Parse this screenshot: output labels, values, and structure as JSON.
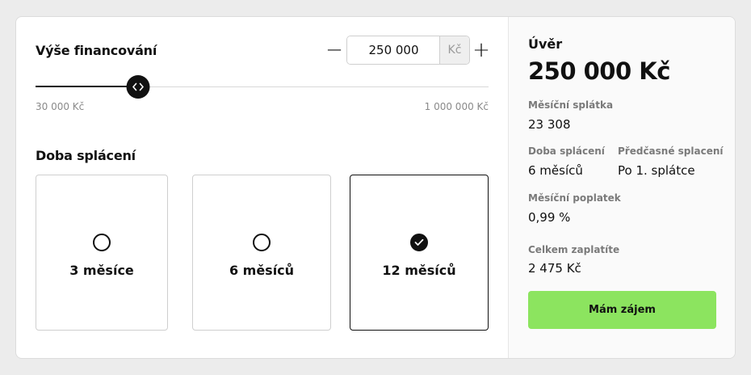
{
  "amount": {
    "title": "Výše financování",
    "minus_label": "−",
    "plus_label": "+",
    "value": "250 000",
    "unit": "Kč",
    "slider_min_label": "30 000 Kč",
    "slider_max_label": "1 000 000 Kč",
    "slider_fraction": 0.227
  },
  "period": {
    "title": "Doba splácení",
    "options": [
      {
        "label": "3 měsíce",
        "selected": false
      },
      {
        "label": "6 měsíců",
        "selected": false
      },
      {
        "label": "12 měsíců",
        "selected": true
      }
    ]
  },
  "summary": {
    "loan_label": "Úvěr",
    "loan_value": "250 000 Kč",
    "monthly_payment_label": "Měsíční splátka",
    "monthly_payment_value": "23 308",
    "duration_label": "Doba splácení",
    "duration_value": "6 měsíců",
    "early_label": "Předčasné splacení",
    "early_value": "Po 1. splátce",
    "fee_label": "Měsíční poplatek",
    "fee_value": "0,99 %",
    "total_label": "Celkem zaplatíte",
    "total_value": "2 475 Kč",
    "cta_label": "Mám zájem"
  },
  "colors": {
    "accent": "#8ce45f",
    "dark": "#111111"
  }
}
